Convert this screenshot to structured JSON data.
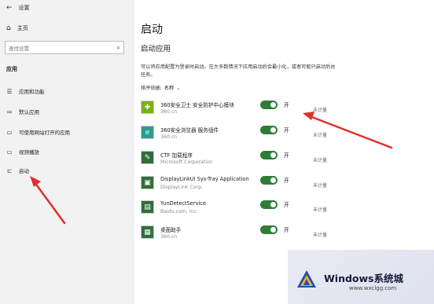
{
  "window": {
    "title": "设置",
    "back_icon": "back-arrow-icon"
  },
  "sidebar": {
    "home_label": "主页",
    "search_placeholder": "查找设置",
    "section_label": "应用",
    "items": [
      {
        "label": "应用和功能",
        "icon": "apps-list-icon"
      },
      {
        "label": "默认应用",
        "icon": "default-apps-icon"
      },
      {
        "label": "可使用网站打开的应用",
        "icon": "websites-apps-icon"
      },
      {
        "label": "视频播放",
        "icon": "video-icon"
      },
      {
        "label": "启动",
        "icon": "startup-icon"
      }
    ]
  },
  "main": {
    "page_title": "启动",
    "subtitle": "启动应用",
    "description": "可以将应用配置为登录时启动。在大多数情况下应用启动后会最小化，或者可能只启动后台任务。",
    "sort_label": "排序依据:",
    "sort_value": "名称",
    "apps": [
      {
        "name": "360安全卫士 安全防护中心模块",
        "publisher": "360.cn",
        "toggle": "开",
        "enabled": true,
        "impact": "未计量",
        "icon_color": "#7ab317",
        "icon_glyph": "✚"
      },
      {
        "name": "360安全浏览器 服务组件",
        "publisher": "360.cn",
        "toggle": "开",
        "enabled": true,
        "impact": "未计量",
        "icon_color": "#2a9d8f",
        "icon_glyph": "e"
      },
      {
        "name": "CTF 加载程序",
        "publisher": "Microsoft Corporation",
        "toggle": "开",
        "enabled": true,
        "impact": "未计量",
        "icon_color": "#2f6e3a",
        "icon_glyph": "✎"
      },
      {
        "name": "DisplayLinkUI Sys-Tray Application",
        "publisher": "DisplayLink Corp.",
        "toggle": "开",
        "enabled": true,
        "impact": "未计量",
        "icon_color": "#2f6e3a",
        "icon_glyph": "▣"
      },
      {
        "name": "YunDetectService",
        "publisher": "Baidu.com, Inc.",
        "toggle": "开",
        "enabled": true,
        "impact": "未计量",
        "icon_color": "#2f6e3a",
        "icon_glyph": "▤"
      },
      {
        "name": "桌面助手",
        "publisher": "360.cn",
        "toggle": "开",
        "enabled": true,
        "impact": "未计量",
        "icon_color": "#2f6e3a",
        "icon_glyph": "▦"
      }
    ]
  },
  "watermark": {
    "title": "Windows系统城",
    "url": "www.wxclgg.com"
  },
  "colors": {
    "toggle_on": "#2d7d3a",
    "annotation_arrow": "#e0302a",
    "sidebar_bg": "#f2f2f2"
  }
}
